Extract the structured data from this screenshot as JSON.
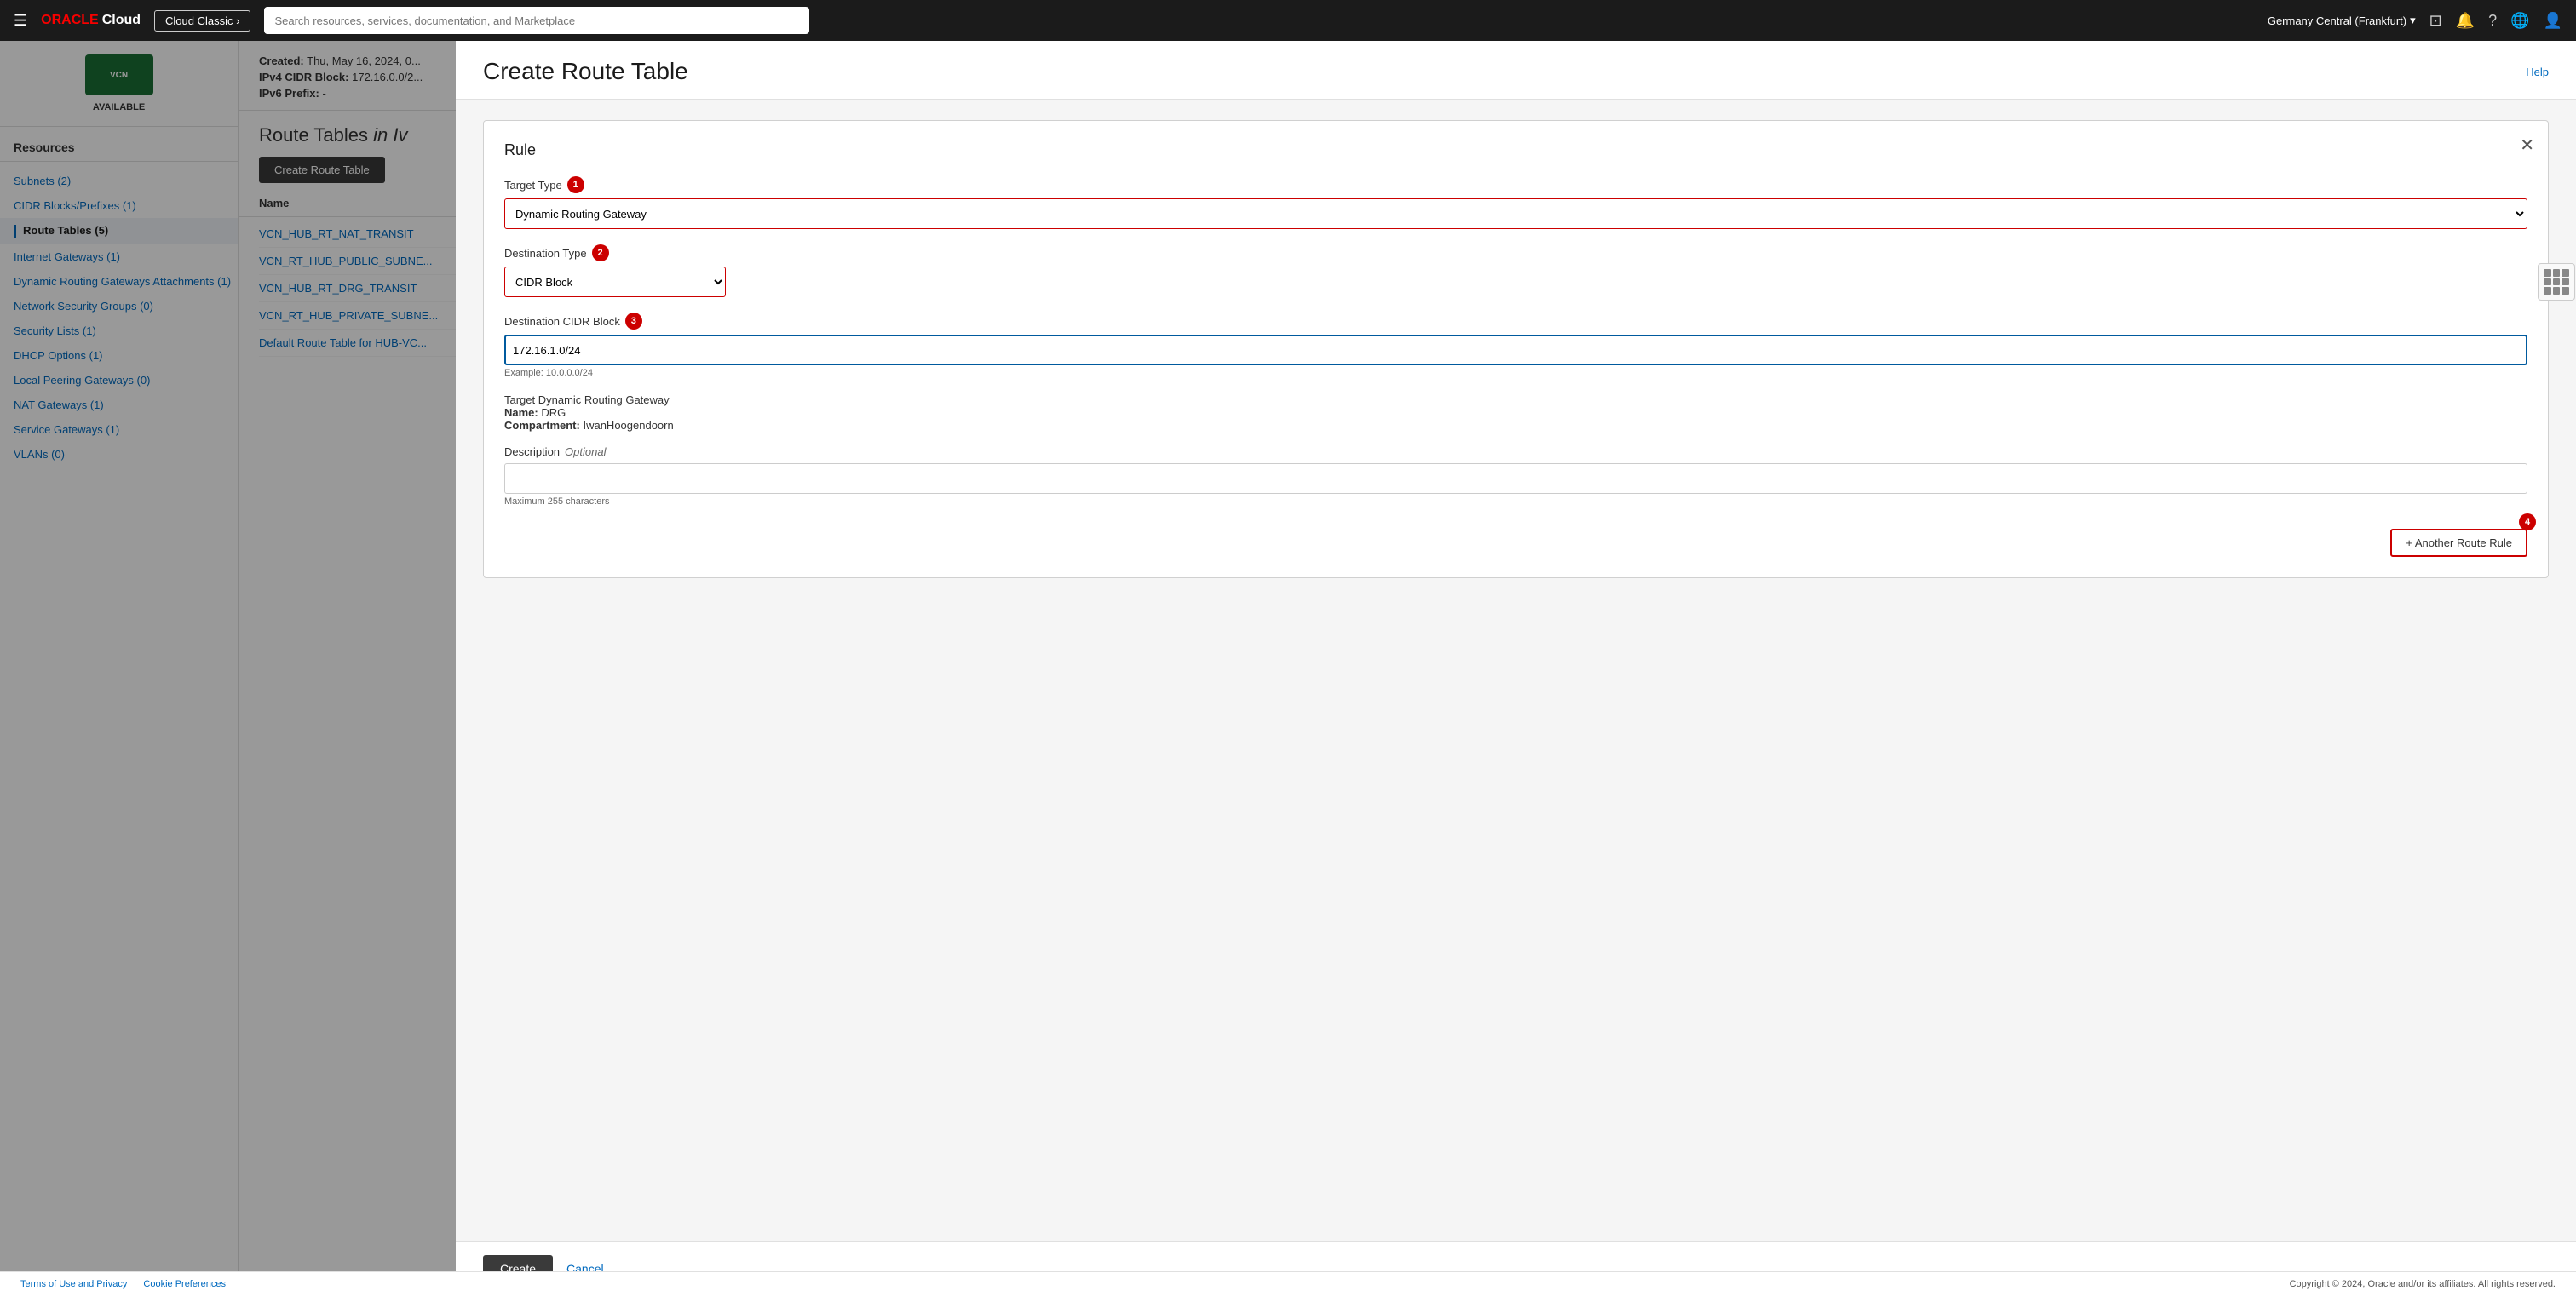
{
  "topnav": {
    "hamburger_icon": "☰",
    "oracle_text": "ORACLE",
    "cloud_text": "Cloud",
    "cloud_classic_label": "Cloud Classic ›",
    "search_placeholder": "Search resources, services, documentation, and Marketplace",
    "region": "Germany Central (Frankfurt)",
    "chevron_icon": "▾",
    "monitor_icon": "⊡",
    "bell_icon": "🔔",
    "help_icon": "?",
    "globe_icon": "🌐",
    "user_icon": "👤"
  },
  "sidebar": {
    "logo_text": "VCN",
    "available_label": "AVAILABLE",
    "resources_title": "Resources",
    "items": [
      {
        "id": "subnets",
        "label": "Subnets (2)"
      },
      {
        "id": "cidr",
        "label": "CIDR Blocks/Prefixes (1)"
      },
      {
        "id": "route-tables",
        "label": "Route Tables (5)",
        "active": true
      },
      {
        "id": "internet-gateways",
        "label": "Internet Gateways (1)"
      },
      {
        "id": "drg-attachments",
        "label": "Dynamic Routing Gateways Attachments (1)"
      },
      {
        "id": "network-security",
        "label": "Network Security Groups (0)"
      },
      {
        "id": "security-lists",
        "label": "Security Lists (1)"
      },
      {
        "id": "dhcp-options",
        "label": "DHCP Options (1)"
      },
      {
        "id": "local-peering",
        "label": "Local Peering Gateways (0)"
      },
      {
        "id": "nat-gateways",
        "label": "NAT Gateways (1)"
      },
      {
        "id": "service-gateways",
        "label": "Service Gateways (1)"
      },
      {
        "id": "vlans",
        "label": "VLANs (0)"
      }
    ]
  },
  "content_header": {
    "created_label": "Created:",
    "created_value": "Thu, May 16, 2024, 0...",
    "ipv4_label": "IPv4 CIDR Block:",
    "ipv4_value": "172.16.0.0/2...",
    "ipv6_label": "IPv6 Prefix:",
    "ipv6_value": "-"
  },
  "route_tables": {
    "section_title": "Route Tables",
    "section_title_in": "in Iv",
    "create_btn_label": "Create Route Table",
    "column_name": "Name",
    "rows": [
      {
        "name": "VCN_HUB_RT_NAT_TRANSIT"
      },
      {
        "name": "VCN_RT_HUB_PUBLIC_SUBNE..."
      },
      {
        "name": "VCN_HUB_RT_DRG_TRANSIT"
      },
      {
        "name": "VCN_RT_HUB_PRIVATE_SUBNE..."
      },
      {
        "name": "Default Route Table for HUB-VC..."
      }
    ]
  },
  "modal": {
    "title": "Create Route Table",
    "help_label": "Help",
    "close_icon": "✕",
    "create_btn": "Create",
    "cancel_btn": "Cancel",
    "rule": {
      "title": "Rule",
      "target_type_label": "Target Type",
      "target_type_badge": "1",
      "target_type_value": "Dynamic Routing Gateway",
      "destination_type_label": "Destination Type",
      "destination_type_badge": "2",
      "destination_type_value": "CIDR Block",
      "destination_cidr_label": "Destination CIDR Block",
      "destination_cidr_badge": "3",
      "destination_cidr_value": "172.16.1.0/24",
      "destination_cidr_hint": "Example: 10.0.0.0/24",
      "target_drg_label": "Target Dynamic Routing Gateway",
      "drg_name_label": "Name:",
      "drg_name_value": "DRG",
      "drg_compartment_label": "Compartment:",
      "drg_compartment_value": "IwanHoogendoorn",
      "description_label": "Description",
      "description_optional": "Optional",
      "description_value": "",
      "description_maxchars": "Maximum 255 characters",
      "another_rule_btn": "+ Another Route Rule",
      "another_rule_badge": "4"
    }
  },
  "footer": {
    "terms": "Terms of Use and Privacy",
    "cookies": "Cookie Preferences",
    "copyright": "Copyright © 2024, Oracle and/or its affiliates. All rights reserved."
  }
}
